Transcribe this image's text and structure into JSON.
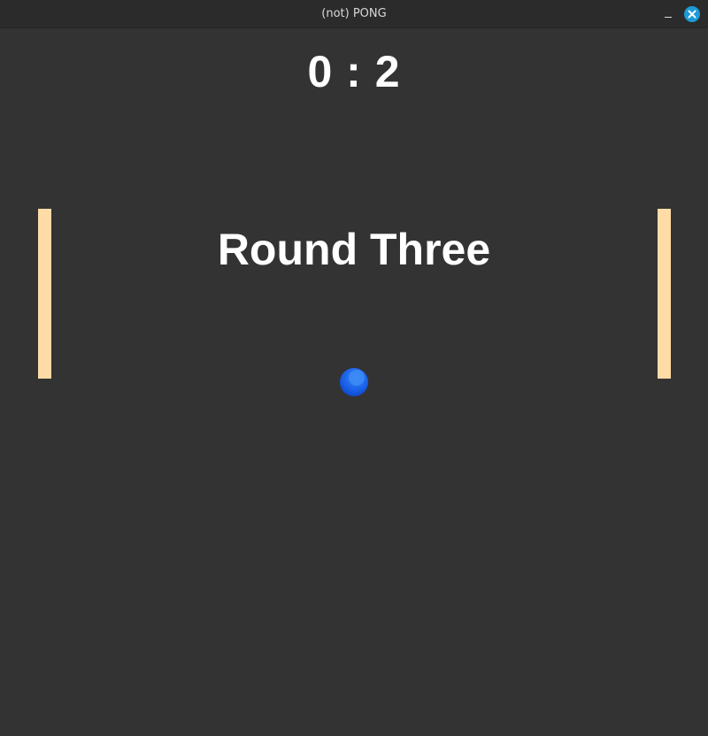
{
  "window": {
    "title": "(not) PONG",
    "controls": {
      "minimize_icon": "minimize-icon",
      "close_icon": "close-icon",
      "close_color": "#1e9bd7"
    }
  },
  "game": {
    "score": "0 : 2",
    "round_label": "Round Three",
    "colors": {
      "background": "#333333",
      "paddle": "#ffdba6",
      "ball": "#1a5de6",
      "text": "#ffffff"
    }
  }
}
